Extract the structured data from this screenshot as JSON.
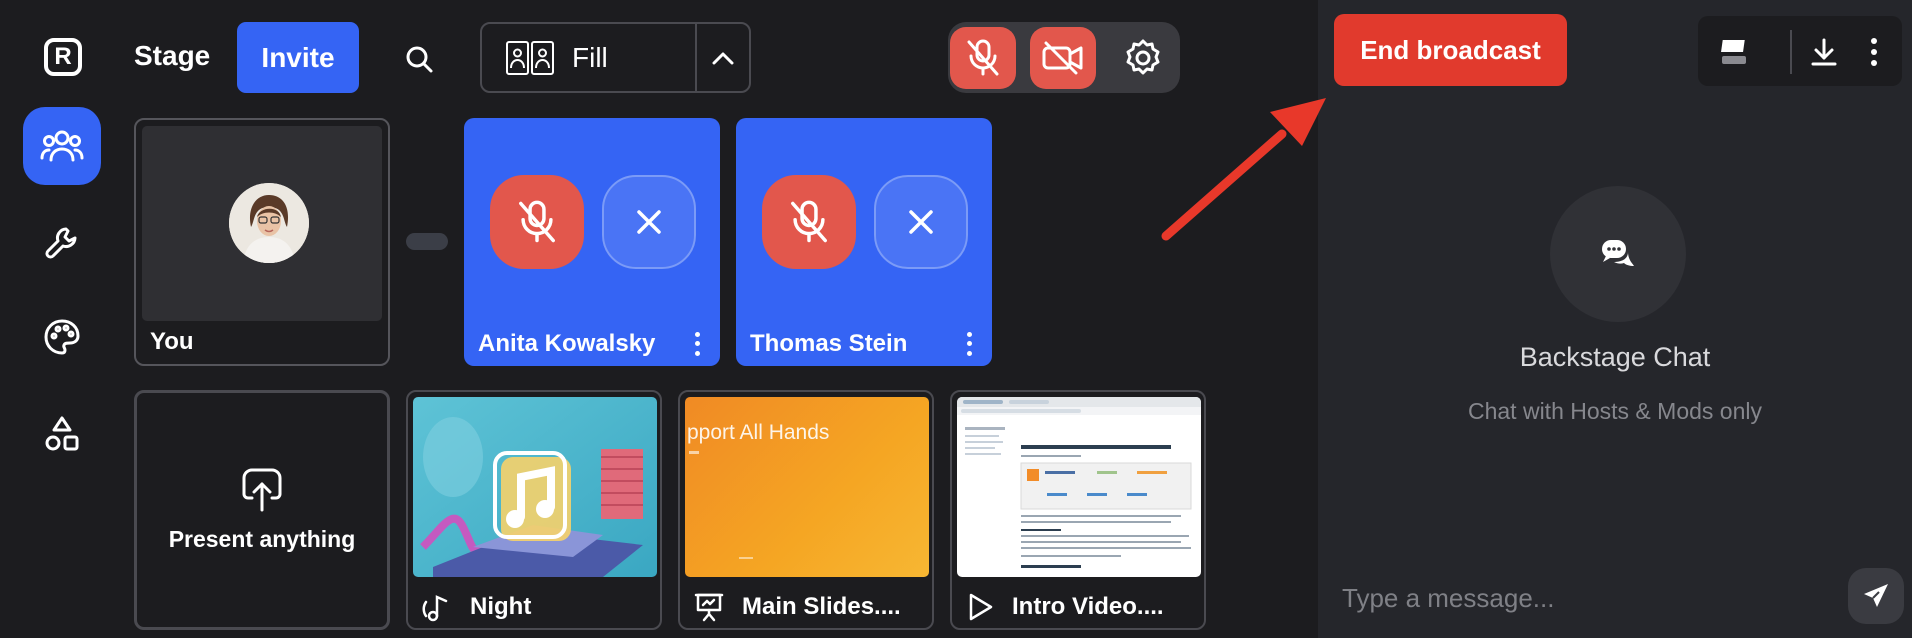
{
  "topbar": {
    "stage_tab": "Stage",
    "invite_label": "Invite",
    "layout_label": "Fill"
  },
  "stage": {
    "self_name": "You",
    "guests": [
      {
        "name": "Anita Kowalsky"
      },
      {
        "name": "Thomas Stein"
      }
    ]
  },
  "media": {
    "present_label": "Present anything",
    "items": [
      {
        "title": "Night",
        "icon": "music-note-icon"
      },
      {
        "title": "Main Slides....",
        "icon": "presentation-icon",
        "thumb_text": "pport All Hands"
      },
      {
        "title": "Intro Video....",
        "icon": "play-icon"
      }
    ]
  },
  "panel": {
    "end_label": "End broadcast",
    "chat_title": "Backstage Chat",
    "chat_subtitle": "Chat with Hosts & Mods only",
    "input_placeholder": "Type a message..."
  },
  "colors": {
    "accent_blue": "#3564f4",
    "danger_red": "#e13a2d",
    "mic_red": "#e2574c",
    "background": "#1c1c1f",
    "panel_background": "#25262b"
  }
}
